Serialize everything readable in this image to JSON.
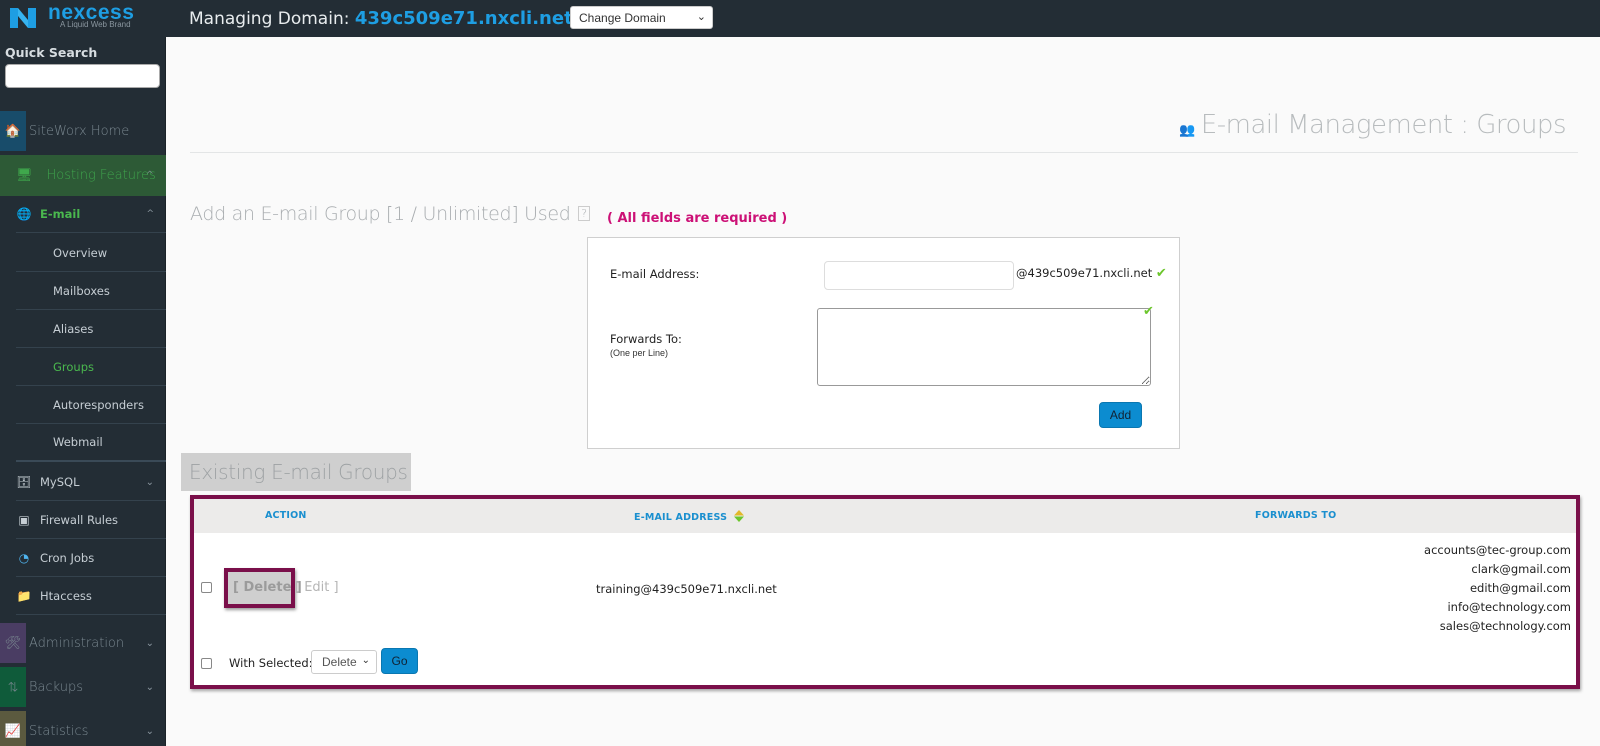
{
  "header": {
    "brand": "nexcess",
    "brand_sub": "A Liquid Web Brand",
    "managing_label": "Managing Domain:",
    "domain": "439c509e71.nxcli.net",
    "change_domain": {
      "selected": "Change Domain",
      "icon": "chevron-down-icon"
    }
  },
  "sidebar": {
    "quick_search_label": "Quick Search",
    "quick_search_value": "",
    "sections": [
      {
        "label": "SiteWorx Home",
        "icon": "home-icon"
      },
      {
        "label": "Hosting Features",
        "icon": "monitor-icon",
        "expanded": true,
        "active": true
      },
      {
        "label": "Administration",
        "icon": "tools-icon",
        "expanded": false
      },
      {
        "label": "Backups",
        "icon": "backup-arrows-icon",
        "expanded": false
      },
      {
        "label": "Statistics",
        "icon": "chart-icon",
        "expanded": false
      }
    ],
    "hosting_items": [
      {
        "label": "E-mail",
        "icon": "email-globe-icon",
        "expanded": true,
        "active": true
      },
      {
        "label": "MySQL",
        "icon": "database-icon",
        "expanded": false
      },
      {
        "label": "Firewall Rules",
        "icon": "firewall-icon"
      },
      {
        "label": "Cron Jobs",
        "icon": "clock-icon"
      },
      {
        "label": "Htaccess",
        "icon": "folder-icon"
      }
    ],
    "email_items": [
      {
        "label": "Overview",
        "active": false
      },
      {
        "label": "Mailboxes",
        "active": false
      },
      {
        "label": "Aliases",
        "active": false
      },
      {
        "label": "Groups",
        "active": true
      },
      {
        "label": "Autoresponders",
        "active": false
      },
      {
        "label": "Webmail",
        "active": false
      }
    ]
  },
  "page": {
    "title": "E-mail Management : Groups",
    "title_icon": "users-icon",
    "add_heading": "Add an E-mail Group [1 / Unlimited] Used",
    "help_label": "?",
    "required_note": "( All fields are required )",
    "form": {
      "email_label": "E-mail Address:",
      "email_value": "",
      "email_suffix": "@439c509e71.nxcli.net",
      "forwards_label": "Forwards To:",
      "forwards_sub": "(One per Line)",
      "forwards_value": "",
      "add_button": "Add"
    },
    "existing_heading": "Existing E-mail Groups",
    "table": {
      "columns": [
        "ACTION",
        "E-MAIL ADDRESS",
        "FORWARDS TO"
      ],
      "rows": [
        {
          "checked": false,
          "delete_label": "[ Delete ]",
          "edit_label": "[ Edit ]",
          "email": "training@439c509e71.nxcli.net",
          "forwards": [
            "accounts@tec-group.com",
            "clark@gmail.com",
            "edith@gmail.com",
            "info@technology.com",
            "sales@technology.com"
          ]
        }
      ],
      "with_selected_label": "With Selected:",
      "with_selected_option": "Delete",
      "go_button": "Go"
    }
  },
  "colors": {
    "accent_blue": "#1e9ee3",
    "active_green": "#4ab84e",
    "required_magenta": "#cc1076",
    "highlight_border": "#7a0f4a",
    "button_blue": "#0c8cd0"
  }
}
